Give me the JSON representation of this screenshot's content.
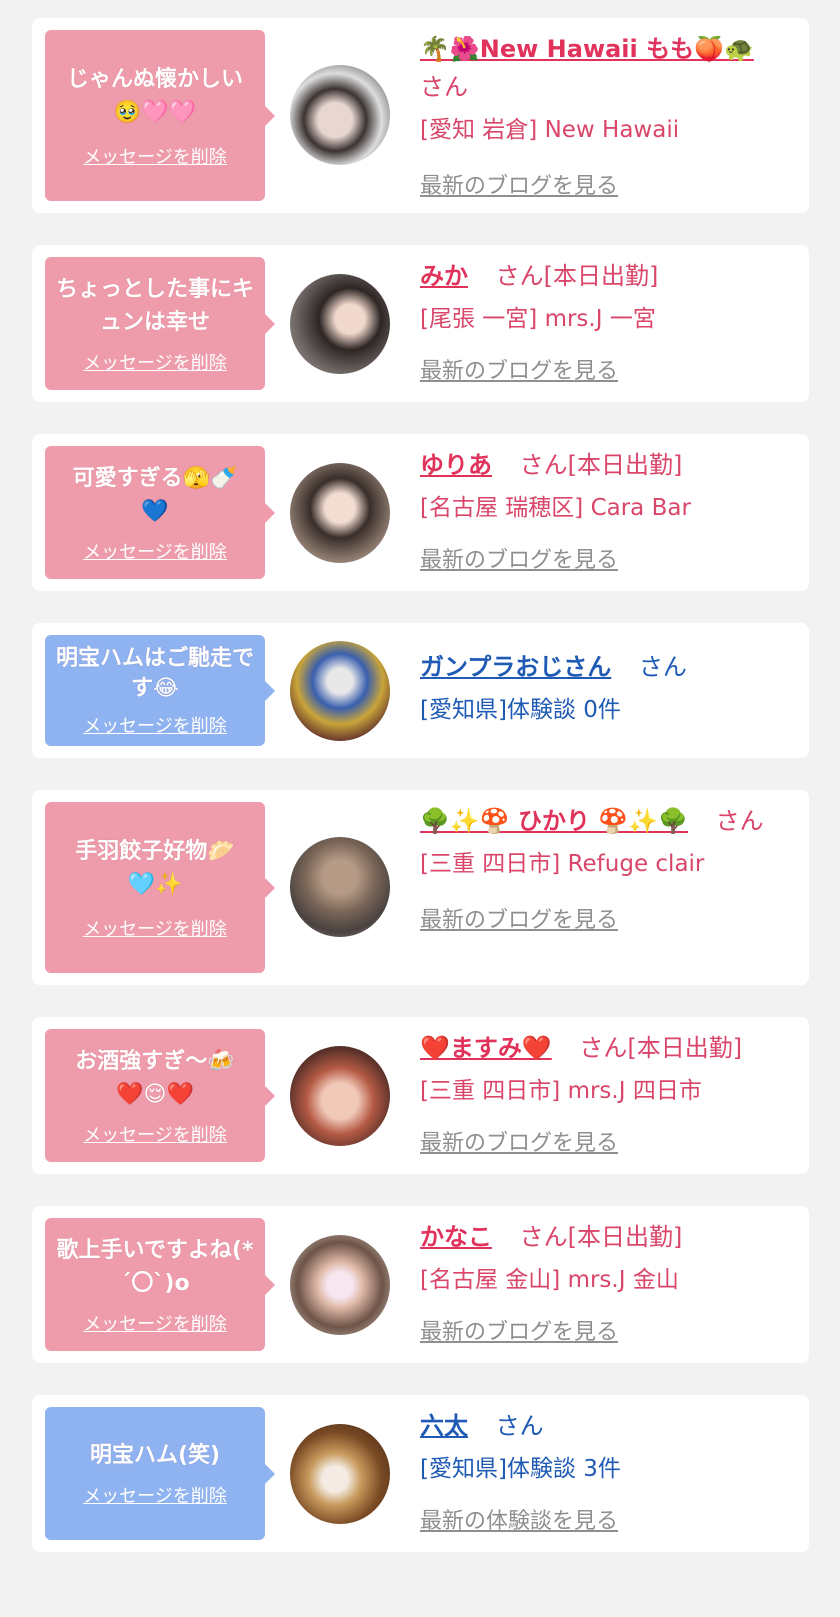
{
  "delete_label": "メッセージを削除",
  "items": [
    {
      "message": "じゃんぬ懐かしい🥹🩷🩷",
      "name": "🌴🌺New Hawaii もも🍑🐢",
      "suffix": "さん",
      "shop": "[愛知 岩倉] New Hawaii",
      "link": "最新のブログを見る"
    },
    {
      "message": "ちょっとした事にキュンは幸せ",
      "name": "みか",
      "suffix": "さん[本日出勤]",
      "shop": "[尾張 一宮] mrs.J 一宮",
      "link": "最新のブログを見る"
    },
    {
      "message": "可愛すぎる🫣🍼💙",
      "name": "ゆりあ",
      "suffix": "さん[本日出勤]",
      "shop": "[名古屋 瑞穂区] Cara Bar",
      "link": "最新のブログを見る"
    },
    {
      "message": "明宝ハムはご馳走です😂",
      "name": "ガンプラおじさん",
      "suffix": "さん",
      "shop": "[愛知県]体験談 0件",
      "link": ""
    },
    {
      "message": "手羽餃子好物🥟🩵✨",
      "name": "🌳✨🍄 ひかり 🍄✨🌳",
      "suffix": "さん",
      "shop": "[三重 四日市] Refuge clair",
      "link": "最新のブログを見る"
    },
    {
      "message": "お酒強すぎ〜🍻❤️😌❤️",
      "name": "❤️ますみ❤️",
      "suffix": "さん[本日出勤]",
      "shop": "[三重 四日市] mrs.J 四日市",
      "link": "最新のブログを見る"
    },
    {
      "message": "歌上手いですよね(*´〇`)o",
      "name": "かなこ",
      "suffix": "さん[本日出勤]",
      "shop": "[名古屋 金山] mrs.J 金山",
      "link": "最新のブログを見る"
    },
    {
      "message": "明宝ハム(笑)",
      "name": "六太",
      "suffix": "さん",
      "shop": "[愛知県]体験談 3件",
      "link": "最新の体験談を見る"
    }
  ]
}
